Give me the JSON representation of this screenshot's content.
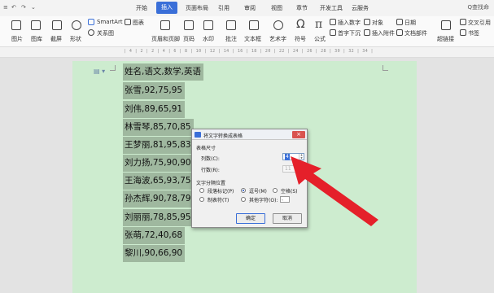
{
  "quick_access": {
    "menu": "≡",
    "undo": "↶",
    "redo": "↷",
    "customize": "⌄"
  },
  "menu": {
    "tabs": [
      "开始",
      "插入",
      "页面布局",
      "引用",
      "审阅",
      "视图",
      "章节",
      "开发工具",
      "云服务"
    ],
    "active_index": 1,
    "search": "Q查找命"
  },
  "ribbon": {
    "items": [
      "图片",
      "图库",
      "截屏",
      "形状",
      "SmartArt",
      "关系图",
      "图表",
      "页眉和页脚",
      "页码",
      "水印",
      "批注",
      "文本框",
      "艺术字",
      "符号",
      "公式",
      "插入数字",
      "首字下沉",
      "对象",
      "插入附件",
      "日期",
      "文档部件",
      "超链接",
      "交叉引用",
      "书签"
    ],
    "accent_color": "#3a6fd8"
  },
  "ruler": {
    "scale": "| 4 |   2   |     2  |  4  |  6  |  8  |  10 |  12 |  14 |  16 |  18 |  20 |  22 |  24 |  26 |  28 |  30 |  32 |  34 |"
  },
  "document": {
    "para_icon": "▤ ▾",
    "lines": [
      "姓名,语文,数学,英语",
      "张雪,92,75,95",
      "刘伟,89,65,91",
      "林雪琴,85,70,85",
      "王梦丽,81,95,83",
      "刘力扬,75,90,90",
      "王海波,65,93,75",
      "孙杰辉,90,78,79",
      "刘丽丽,78,85,95",
      "张萌,72,40,68",
      "黎川,90,66,90"
    ]
  },
  "dialog": {
    "title": "将文字转换成表格",
    "close": "×",
    "section_size": "表格尺寸",
    "cols_label": "列数(C):",
    "cols_value": "4",
    "rows_label": "行数(R):",
    "rows_value": "11",
    "section_sep": "文字分隔位置",
    "sep_options": [
      "段落标记(P)",
      "逗号(M)",
      "空格(S)",
      "制表符(T)",
      "其他字符(O):"
    ],
    "sep_selected": 1,
    "other_char": "、",
    "ok": "确定",
    "cancel": "取消"
  },
  "annotation": {
    "arrow_color": "#e5202a"
  }
}
